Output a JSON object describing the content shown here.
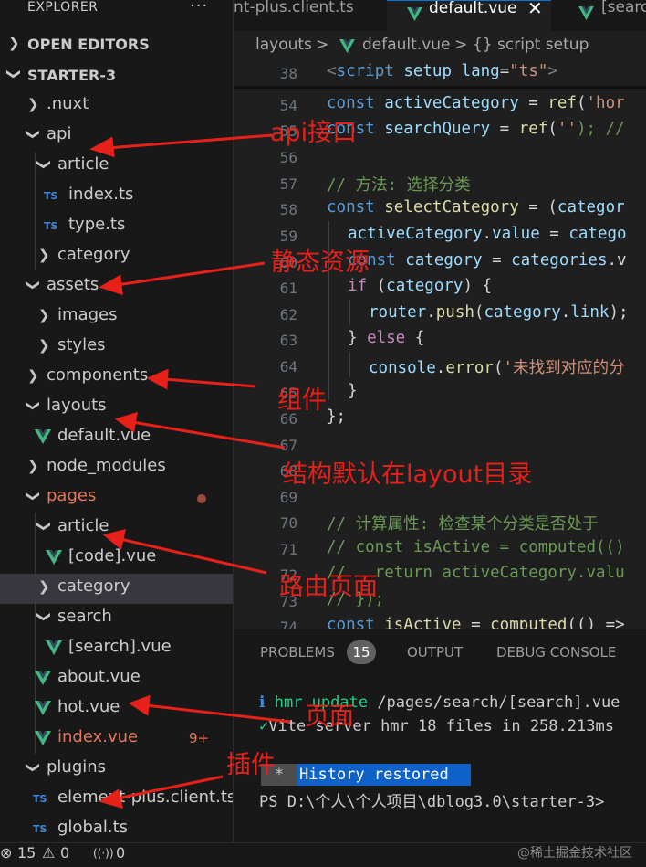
{
  "sidebar": {
    "title": "EXPLORER",
    "more": "···",
    "open_editors": "OPEN EDITORS",
    "project": "STARTER-3",
    "tree": {
      "nuxt": ".nuxt",
      "api": "api",
      "article": "article",
      "index_ts": "index.ts",
      "type_ts": "type.ts",
      "category": "category",
      "assets": "assets",
      "images": "images",
      "styles": "styles",
      "components": "components",
      "layouts": "layouts",
      "default_vue": "default.vue",
      "node_modules": "node_modules",
      "pages": "pages",
      "pages_article": "article",
      "code_vue": "[code].vue",
      "pages_category": "category",
      "search": "search",
      "search_vue": "[search].vue",
      "about_vue": "about.vue",
      "hot_vue": "hot.vue",
      "index_vue": "index.vue",
      "index_vue_badge": "9+",
      "plugins": "plugins",
      "element_plus": "element-plus.client.ts",
      "global_ts": "global.ts"
    },
    "ts_icon": "TS"
  },
  "tabs": {
    "tab1": "nt-plus.client.ts",
    "tab2": "default.vue",
    "tab3": "[searc",
    "close": "✕"
  },
  "breadcrumb": {
    "part1": "layouts",
    "sep": ">",
    "part2": "default.vue",
    "part3": "{} script setup"
  },
  "editor": {
    "line_numbers": [
      "38",
      "54",
      "55",
      "56",
      "57",
      "58",
      "59",
      "60",
      "61",
      "62",
      "63",
      "64",
      "65",
      "66",
      "67",
      "68",
      "69",
      "70",
      "71",
      "72",
      "73",
      "74"
    ],
    "sticky": {
      "open": "<",
      "tag": "script",
      "a1": "setup",
      "a2": "lang",
      "eq": "=",
      "val": "\"ts\"",
      "close": ">"
    },
    "l54": {
      "kw": "const",
      "var": "activeCategory",
      "eq": " = ",
      "fn": "ref",
      "p": "(",
      "str": "'hor"
    },
    "l55": {
      "kw": "const",
      "var": "searchQuery",
      "eq": " = ",
      "fn": "ref",
      "p": "(",
      "str": "''",
      "rest": "); //"
    },
    "l57": {
      "cm": "// 方法: 选择分类"
    },
    "l58": {
      "kw": "const",
      "fn": "selectCategory",
      "eq": " = (",
      "var": "categor"
    },
    "l59": {
      "var1": "activeCategory",
      "dot": ".",
      "var2": "value",
      "eq": " = ",
      "var3": "catego"
    },
    "l60": {
      "kw": "const",
      "var1": "category",
      "eq": " = ",
      "var2": "categories",
      "rest": ".v"
    },
    "l61": {
      "kw": "if",
      "p1": " (",
      "var": "category",
      "p2": ") {"
    },
    "l62": {
      "var1": "router",
      "dot": ".",
      "fn": "push",
      "p": "(",
      "var2": "category",
      "dot2": ".",
      "var3": "link",
      "rest": ");"
    },
    "l63": {
      "p": "} ",
      "kw": "else",
      "rest": " {"
    },
    "l64": {
      "var": "console",
      "dot": ".",
      "fn": "error",
      "p": "(",
      "str": "'未找到对应的分"
    },
    "l65": {
      "text": "}"
    },
    "l66": {
      "text": "};"
    },
    "l70": {
      "cm": "// 计算属性: 检查某个分类是否处于"
    },
    "l71": {
      "cm": "// const isActive = computed(()"
    },
    "l72": {
      "cm": "//   return activeCategory.valu"
    },
    "l73": {
      "cm": "// });"
    },
    "l74": {
      "kw": "const",
      "var": "isActive",
      "eq": " = ",
      "fn": "computed",
      "rest": "(() =>"
    }
  },
  "panel": {
    "tabs": [
      "PROBLEMS",
      "OUTPUT",
      "DEBUG CONSOLE"
    ],
    "problems_count": "15",
    "terminal": {
      "line1_icon": "ℹ",
      "line1_cmd": "hmr update",
      "line1_path": " /pages/search/[search].vue",
      "line2_icon": "✓",
      "line2_text": "Vite server hmr 18 files in 258.213ms",
      "hist_star": "*",
      "hist_label": "History restored",
      "prompt": "PS D:\\个人\\个人项目\\dblog3.0\\starter-3>"
    }
  },
  "statusbar": {
    "errors_icon": "⊗",
    "errors": "15",
    "warnings_icon": "⚠",
    "warnings": "0",
    "ports_icon": "((·))",
    "ports": "0"
  },
  "watermark": "@稀土掘金技术社区",
  "annotations": {
    "api": "api接口",
    "assets": "静态资源",
    "components": "组件",
    "layouts": "结构默认在layout目录",
    "pages": "路由页面",
    "pages2": "页面",
    "plugins": "插件"
  },
  "colors": {
    "annotation_red": "#e8201a",
    "vue_green": "#41b883",
    "ts_blue": "#3c8ae0",
    "git_modified": "#e2775a",
    "active_tab_border": "#0078d4"
  }
}
